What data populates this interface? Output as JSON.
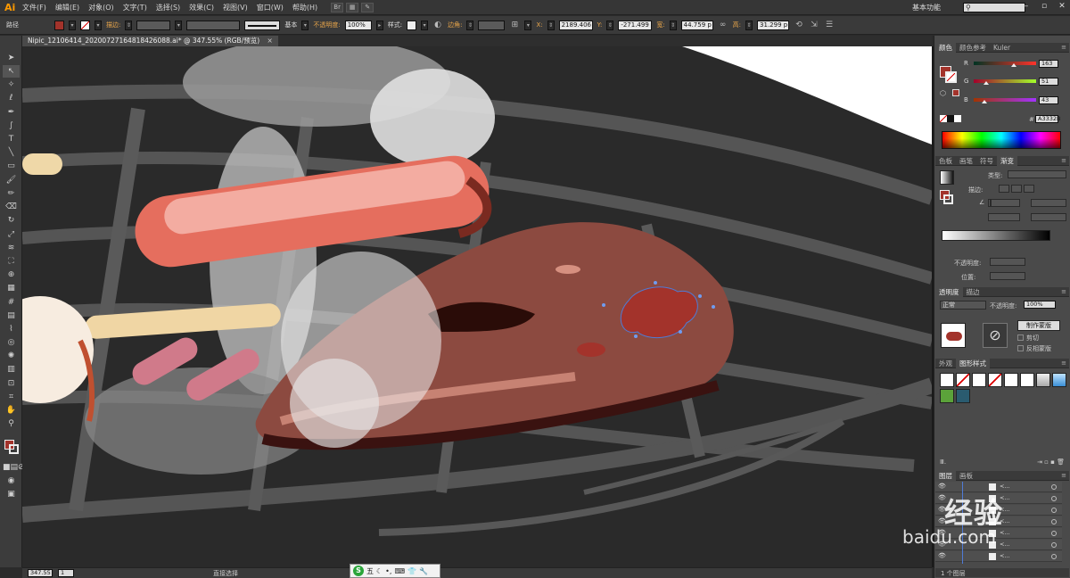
{
  "app": {
    "logo": "Ai"
  },
  "menu": [
    "文件(F)",
    "编辑(E)",
    "对象(O)",
    "文字(T)",
    "选择(S)",
    "效果(C)",
    "视图(V)",
    "窗口(W)",
    "帮助(H)"
  ],
  "workspace": "基本功能",
  "control": {
    "mode_label": "路径",
    "stroke_label": "描边:",
    "stroke_profile": "基本",
    "opacity_label": "不透明度:",
    "opacity_value": "100%",
    "style_label": "样式:",
    "corner_label": "边角:",
    "x_label": "X:",
    "x_value": "2189.406",
    "y_label": "Y:",
    "y_value": "-271.499",
    "w_label": "宽:",
    "w_value": "44.759 p",
    "h_label": "高:",
    "h_value": "31.299 p",
    "fill_color": "#a3332b"
  },
  "document": {
    "tab": "Nipic_12106414_20200727164818426088.ai* @ 347.55% (RGB/预览)",
    "close": "×"
  },
  "status": {
    "zoom": "347.55",
    "page": "1",
    "tool": "直接选择"
  },
  "ime": {
    "logo": "S",
    "mode": "五"
  },
  "color_panel": {
    "tabs": [
      "颜色",
      "颜色参考",
      "Kuler"
    ],
    "r_label": "R",
    "r_value": "163",
    "g_label": "G",
    "g_value": "51",
    "b_label": "B",
    "b_value": "43",
    "hex_label": "#",
    "hex_value": "A3332B",
    "r_frac": 0.64,
    "g_frac": 0.2,
    "b_frac": 0.17
  },
  "gradient_panel": {
    "tabs": [
      "色板",
      "画笔",
      "符号",
      "渐变"
    ],
    "type_label": "类型:",
    "stroke_label": "描边:",
    "opacity_label": "不透明度:",
    "position_label": "位置:"
  },
  "transparency_panel": {
    "tabs": [
      "透明度",
      "描边"
    ],
    "mode": "正常",
    "opacity_label": "不透明度:",
    "opacity_value": "100%",
    "make_mask": "制作蒙版",
    "clip": "剪切",
    "invert_mask": "反相蒙版"
  },
  "styles_panel": {
    "tabs": [
      "外观",
      "图形样式"
    ]
  },
  "layers_panel": {
    "tabs": [
      "图层",
      "画板"
    ],
    "footer": "1 个图层",
    "rows": [
      "<...",
      "<...",
      "<...",
      "<...",
      "<...",
      "<...",
      "<..."
    ]
  },
  "watermark": {
    "title": "经验",
    "sub": "baidu.com"
  }
}
